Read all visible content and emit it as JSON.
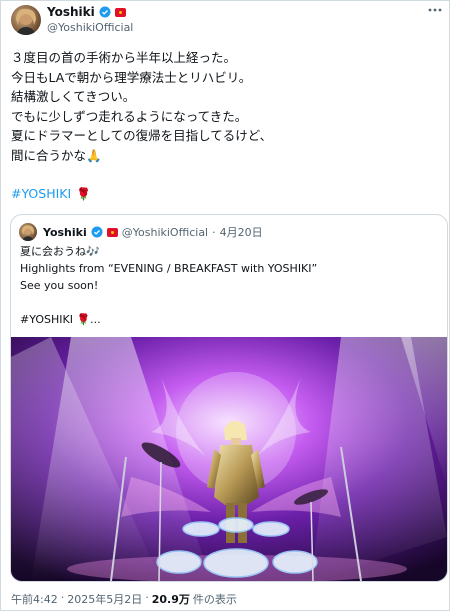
{
  "tweet": {
    "author_name": "Yoshiki",
    "author_handle": "@YoshikiOfficial",
    "body": "３度目の首の手術から半年以上経った。\n今日もLAで朝から理学療法士とリハビリ。\n結構激しくてきつい。\nでもに少しずつ走れるようになってきた。\n夏にドラマーとしての復帰を目指してるけど、\n間に合うかな🙏",
    "hashtag": "#YOSHIKI",
    "rose_icon": "🌹"
  },
  "quote": {
    "author_name": "Yoshiki",
    "author_handle": "@YoshikiOfficial",
    "separator": "·",
    "date": "4月20日",
    "body": "夏に会おうね🎶\nHighlights from “EVENING / BREAKFAST with YOSHIKI”\nSee you soon!\n\n#YOSHIKI 🌹...",
    "media_alt": "performer standing behind a crystal drum kit under purple stage lights"
  },
  "footer": {
    "time": "午前4:42",
    "separator1": "·",
    "date": "2025年5月2日",
    "separator2": "·",
    "views_count": "20.9万",
    "views_label": "件の表示"
  },
  "colors": {
    "accent": "#1d9bf0",
    "verified": "#1d9bf0",
    "border": "#cfd9de",
    "muted": "#536471"
  },
  "icons": [
    "verified-badge-icon",
    "japan-flag-icon",
    "more-options-icon",
    "rose-icon"
  ]
}
